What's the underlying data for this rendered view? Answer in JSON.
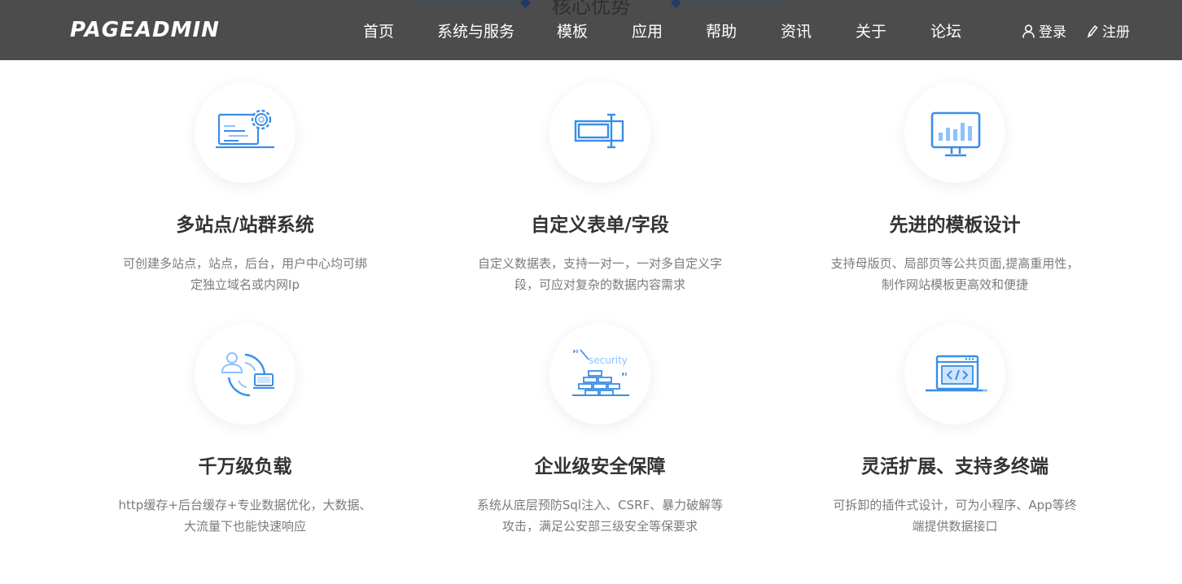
{
  "header": {
    "logo": "PAGEADMIN",
    "behind_title": "核心优势",
    "nav": [
      "首页",
      "系统与服务",
      "模板",
      "应用",
      "帮助",
      "资讯",
      "关于",
      "论坛"
    ],
    "login": "登录",
    "register": "注册"
  },
  "colors": {
    "header_bg": "#4c4c4c",
    "icon_blue": "#3a8ee6",
    "icon_light": "#8cc2ff",
    "title": "#333333",
    "desc": "#7b7b7b"
  },
  "features": [
    {
      "title": "多站点/站群系统",
      "desc1": "可创建多站点，站点，后台，用户中心均可绑",
      "desc2": "定独立域名或内网Ip",
      "icon": "settings-screen-icon"
    },
    {
      "title": "自定义表单/字段",
      "desc1": "自定义数据表，支持一对一，一对多自定义字",
      "desc2": "段，可应对复杂的数据内容需求",
      "icon": "form-field-icon"
    },
    {
      "title": "先进的模板设计",
      "desc1": "支持母版页、局部页等公共页面,提高重用性，",
      "desc2": "制作网站模板更高效和便捷",
      "icon": "monitor-chart-icon"
    },
    {
      "title": "千万级负载",
      "desc1": "http缓存+后台缓存+专业数据优化，大数据、",
      "desc2": "大流量下也能快速响应",
      "icon": "user-load-icon"
    },
    {
      "title": "企业级安全保障",
      "desc1": "系统从底层预防Sql注入、CSRF、暴力破解等",
      "desc2": "攻击，满足公安部三级安全等保要求",
      "icon": "security-wall-icon"
    },
    {
      "title": "灵活扩展、支持多终端",
      "desc1": "可拆卸的插件式设计，可为小程序、App等终",
      "desc2": "端提供数据接口",
      "icon": "code-laptop-icon"
    }
  ],
  "icon_texts": {
    "security": "security"
  }
}
